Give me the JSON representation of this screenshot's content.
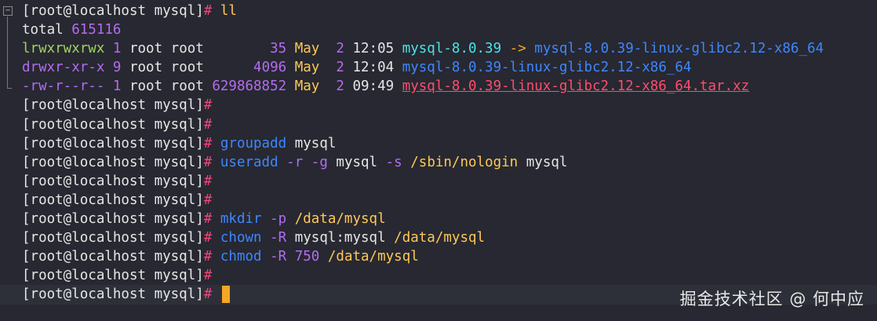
{
  "terminal": {
    "lines": [
      {
        "segments": [
          {
            "text": "[root@localhost mysql]",
            "cls": "c-white"
          },
          {
            "text": "# ",
            "cls": "c-pink"
          },
          {
            "text": "ll",
            "cls": "c-yellow"
          }
        ]
      },
      {
        "segments": [
          {
            "text": "total ",
            "cls": "c-white"
          },
          {
            "text": "615116",
            "cls": "c-purple"
          }
        ]
      },
      {
        "segments": [
          {
            "text": "lrwxrwxrwx ",
            "cls": "c-green"
          },
          {
            "text": "1 ",
            "cls": "c-purple"
          },
          {
            "text": "root root        ",
            "cls": "c-white"
          },
          {
            "text": "35 ",
            "cls": "c-purple"
          },
          {
            "text": "May  ",
            "cls": "c-yellow"
          },
          {
            "text": "2 ",
            "cls": "c-purple"
          },
          {
            "text": "12:05 ",
            "cls": "c-white"
          },
          {
            "text": "mysql-8.0.39",
            "cls": "c-cyan"
          },
          {
            "text": " -> ",
            "cls": "c-orange"
          },
          {
            "text": "mysql-8.0.39-linux-glibc2.12-x86_64",
            "cls": "c-blue"
          }
        ]
      },
      {
        "segments": [
          {
            "text": "drwxr-xr-x ",
            "cls": "c-purple"
          },
          {
            "text": "9 ",
            "cls": "c-purple"
          },
          {
            "text": "root root      ",
            "cls": "c-white"
          },
          {
            "text": "4096 ",
            "cls": "c-purple"
          },
          {
            "text": "May  ",
            "cls": "c-yellow"
          },
          {
            "text": "2 ",
            "cls": "c-purple"
          },
          {
            "text": "12:04 ",
            "cls": "c-white"
          },
          {
            "text": "mysql-8.0.39-linux-glibc2.12-x86_64",
            "cls": "c-blue"
          }
        ]
      },
      {
        "segments": [
          {
            "text": "-rw-r--r-- ",
            "cls": "c-purple"
          },
          {
            "text": "1 ",
            "cls": "c-purple"
          },
          {
            "text": "root root ",
            "cls": "c-white"
          },
          {
            "text": "629868852 ",
            "cls": "c-purple"
          },
          {
            "text": "May  ",
            "cls": "c-yellow"
          },
          {
            "text": "2 ",
            "cls": "c-purple"
          },
          {
            "text": "09:49 ",
            "cls": "c-white"
          },
          {
            "text": "mysql-8.0.39-linux-glibc2.12-x86_64.tar.xz",
            "cls": "c-red underline"
          }
        ]
      },
      {
        "segments": [
          {
            "text": "[root@localhost mysql]",
            "cls": "c-white"
          },
          {
            "text": "#",
            "cls": "c-pink"
          }
        ]
      },
      {
        "segments": [
          {
            "text": "[root@localhost mysql]",
            "cls": "c-white"
          },
          {
            "text": "#",
            "cls": "c-pink"
          }
        ]
      },
      {
        "segments": [
          {
            "text": "[root@localhost mysql]",
            "cls": "c-white"
          },
          {
            "text": "# ",
            "cls": "c-pink"
          },
          {
            "text": "groupadd",
            "cls": "c-blue"
          },
          {
            "text": " mysql",
            "cls": "c-white"
          }
        ]
      },
      {
        "segments": [
          {
            "text": "[root@localhost mysql]",
            "cls": "c-white"
          },
          {
            "text": "# ",
            "cls": "c-pink"
          },
          {
            "text": "useradd",
            "cls": "c-blue"
          },
          {
            "text": " -r -g ",
            "cls": "c-purple"
          },
          {
            "text": "mysql",
            "cls": "c-white"
          },
          {
            "text": " -s ",
            "cls": "c-purple"
          },
          {
            "text": "/sbin/nologin",
            "cls": "c-yellow"
          },
          {
            "text": " mysql",
            "cls": "c-white"
          }
        ]
      },
      {
        "segments": [
          {
            "text": "[root@localhost mysql]",
            "cls": "c-white"
          },
          {
            "text": "#",
            "cls": "c-pink"
          }
        ]
      },
      {
        "segments": [
          {
            "text": "[root@localhost mysql]",
            "cls": "c-white"
          },
          {
            "text": "#",
            "cls": "c-pink"
          }
        ]
      },
      {
        "segments": [
          {
            "text": "[root@localhost mysql]",
            "cls": "c-white"
          },
          {
            "text": "# ",
            "cls": "c-pink"
          },
          {
            "text": "mkdir",
            "cls": "c-blue"
          },
          {
            "text": " -p ",
            "cls": "c-purple"
          },
          {
            "text": "/data/mysql",
            "cls": "c-yellow"
          }
        ]
      },
      {
        "segments": [
          {
            "text": "[root@localhost mysql]",
            "cls": "c-white"
          },
          {
            "text": "# ",
            "cls": "c-pink"
          },
          {
            "text": "chown",
            "cls": "c-blue"
          },
          {
            "text": " -R ",
            "cls": "c-purple"
          },
          {
            "text": "mysql:mysql ",
            "cls": "c-white"
          },
          {
            "text": "/data/mysql",
            "cls": "c-yellow"
          }
        ]
      },
      {
        "segments": [
          {
            "text": "[root@localhost mysql]",
            "cls": "c-white"
          },
          {
            "text": "# ",
            "cls": "c-pink"
          },
          {
            "text": "chmod",
            "cls": "c-blue"
          },
          {
            "text": " -R ",
            "cls": "c-purple"
          },
          {
            "text": "750 ",
            "cls": "c-purple"
          },
          {
            "text": "/data/mysql",
            "cls": "c-yellow"
          }
        ]
      },
      {
        "segments": [
          {
            "text": "[root@localhost mysql]",
            "cls": "c-white"
          },
          {
            "text": "#",
            "cls": "c-pink"
          }
        ]
      },
      {
        "segments": [
          {
            "text": "[root@localhost mysql]",
            "cls": "c-white"
          },
          {
            "text": "# ",
            "cls": "c-pink"
          }
        ],
        "cursor": true,
        "current": true
      }
    ]
  },
  "watermark": {
    "text": "掘金技术社区 @ 何中应"
  },
  "icons": {
    "fold": "fold-collapse-icon"
  }
}
